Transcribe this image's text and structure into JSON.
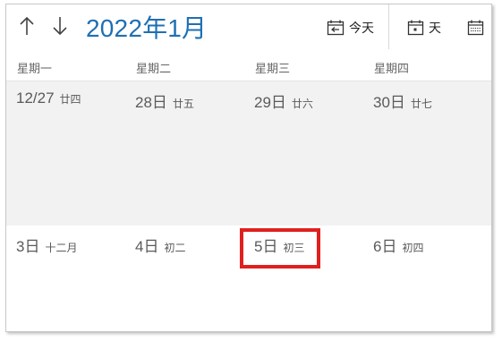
{
  "toolbar": {
    "prev_icon": "up-arrow-icon",
    "next_icon": "down-arrow-icon",
    "month_title": "2022年1月",
    "today_label": "今天",
    "day_label": "天",
    "month_view_icon": "calendar-month-icon"
  },
  "weekdays": [
    "星期一",
    "星期二",
    "星期三",
    "星期四"
  ],
  "weeks": [
    [
      {
        "date": "12/27",
        "lunar": "廿四"
      },
      {
        "date": "28日",
        "lunar": "廿五"
      },
      {
        "date": "29日",
        "lunar": "廿六"
      },
      {
        "date": "30日",
        "lunar": "廿七"
      }
    ],
    [
      {
        "date": "3日",
        "lunar": "十二月"
      },
      {
        "date": "4日",
        "lunar": "初二"
      },
      {
        "date": "5日",
        "lunar": "初三"
      },
      {
        "date": "6日",
        "lunar": "初四"
      }
    ]
  ],
  "colors": {
    "title": "#1f6fb3",
    "highlight": "#e0201e",
    "week1_background": "#f2f2f2"
  }
}
